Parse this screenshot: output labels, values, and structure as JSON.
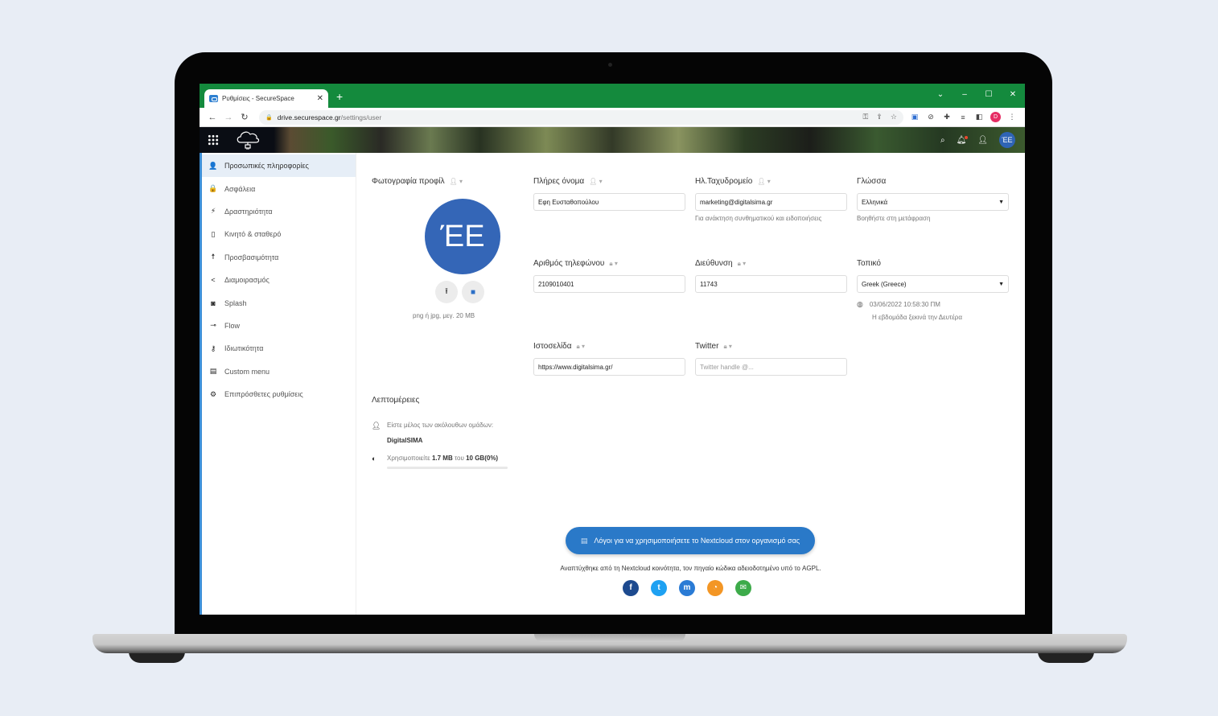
{
  "browser": {
    "tab_title": "Ρυθμίσεις - SecureSpace",
    "tab_close": "✕",
    "new_tab": "+",
    "url_host": "drive.securespace.gr",
    "url_path": "/settings/user",
    "window_controls": [
      "⌄",
      "–",
      "☐",
      "✕"
    ],
    "profile_initial": "D"
  },
  "header": {
    "avatar_initials": "ΈΕ"
  },
  "sidebar": {
    "items": [
      {
        "label": "Προσωπικές πληροφορίες",
        "icon": "user-icon",
        "glyph": "👤",
        "active": true
      },
      {
        "label": "Ασφάλεια",
        "icon": "lock-icon",
        "glyph": "🔒"
      },
      {
        "label": "Δραστηριότητα",
        "icon": "lightning-icon",
        "glyph": "⚡"
      },
      {
        "label": "Κινητό & σταθερό",
        "icon": "phone-icon",
        "glyph": "▯"
      },
      {
        "label": "Προσβασιμότητα",
        "icon": "accessibility-icon",
        "glyph": "☨"
      },
      {
        "label": "Διαμοιρασμός",
        "icon": "share-icon",
        "glyph": "<"
      },
      {
        "label": "Splash",
        "icon": "camera-icon",
        "glyph": "◙"
      },
      {
        "label": "Flow",
        "icon": "flow-icon",
        "glyph": "⊸"
      },
      {
        "label": "Ιδιωτικότητα",
        "icon": "key-icon",
        "glyph": "⚷"
      },
      {
        "label": "Custom menu",
        "icon": "menu-icon",
        "glyph": "▤"
      },
      {
        "label": "Επιπρόσθετες ρυθμίσεις",
        "icon": "gear-icon",
        "glyph": "⚙"
      }
    ]
  },
  "profile": {
    "photo_label": "Φωτογραφία προφίλ",
    "avatar_initials": "ΈΕ",
    "photo_hint": "png ή jpg, μεγ. 20 MB",
    "full_name_label": "Πλήρες όνομα",
    "full_name_value": "Εφη Ευσταθοπούλου",
    "email_label": "Ηλ.Ταχυδρομείο",
    "email_value": "marketing@digitalsima.gr",
    "email_hint": "Για ανάκτηση συνθηματικού και ειδοποιήσεις",
    "language_label": "Γλώσσα",
    "language_value": "Ελληνικά",
    "language_hint": "Βοηθήστε στη μετάφραση",
    "phone_label": "Αριθμός τηλεφώνου",
    "phone_value": "2109010401",
    "address_label": "Διεύθυνση",
    "address_value": "11743",
    "locale_label": "Τοπικό",
    "locale_value": "Greek (Greece)",
    "locale_time": "03/06/2022 10:58:30 ΠΜ",
    "locale_week": "Η εβδομάδα ξεκινά την Δευτέρα",
    "website_label": "Ιστοσελίδα",
    "website_value": "https://www.digitalsima.gr/",
    "twitter_label": "Twitter",
    "twitter_placeholder": "Twitter handle @..."
  },
  "details": {
    "title": "Λεπτομέρειες",
    "groups_text": "Είστε μέλος των ακόλουθων ομάδων:",
    "group_name": "DigitalSIMA",
    "quota_prefix": "Χρησιμοποιείτε",
    "quota_used": "1.7 MB",
    "quota_of": "του",
    "quota_total": "10 GB",
    "quota_percent_text": "(0%)",
    "quota_fraction": 0.0
  },
  "footer": {
    "cta_label": "Λόγοι για να χρησιμοποιήσετε το Nextcloud στον οργανισμό σας",
    "text": "Αναπτύχθηκε από τη Nextcloud κοινότητα, τον πηγαίο κώδικα αδειοδοτημένο υπό το AGPL.",
    "social": [
      {
        "name": "facebook",
        "glyph": "f",
        "color": "#1d4a8f"
      },
      {
        "name": "twitter",
        "glyph": "t",
        "color": "#1ea1f2"
      },
      {
        "name": "mastodon",
        "glyph": "m",
        "color": "#2a7bd5"
      },
      {
        "name": "rss",
        "glyph": "◔",
        "color": "#f39625"
      },
      {
        "name": "email",
        "glyph": "✉",
        "color": "#3dab4a"
      }
    ]
  }
}
